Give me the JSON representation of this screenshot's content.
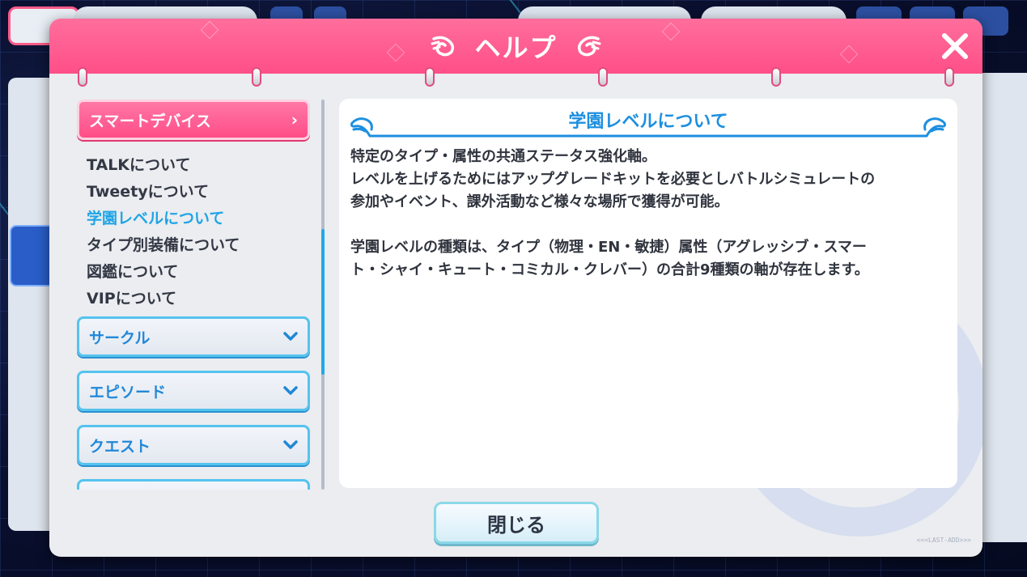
{
  "modal": {
    "title": "ヘルプ",
    "close_icon": "close-icon",
    "bottom_button": "閉じる",
    "watermark": "<<<LAST-ADD>>>"
  },
  "nav": {
    "active_category": "スマートデバイス",
    "sub_items": [
      {
        "label": "TALKについて",
        "active": false
      },
      {
        "label": "Tweetyについて",
        "active": false
      },
      {
        "label": "学園レベルについて",
        "active": true
      },
      {
        "label": "タイプ別装備について",
        "active": false
      },
      {
        "label": "図鑑について",
        "active": false
      },
      {
        "label": "VIPについて",
        "active": false
      }
    ],
    "categories": [
      "サークル",
      "エピソード",
      "クエスト"
    ]
  },
  "content": {
    "title": "学園レベルについて",
    "paragraph1": "特定のタイプ・属性の共通ステータス強化軸。\nレベルを上げるためにはアップグレードキットを必要としバトルシミュレートの\n参加やイベント、課外活動など様々な場所で獲得が可能。",
    "paragraph2": "学園レベルの種類は、タイプ（物理・EN・敏捷）属性（アグレッシブ・スマー\nト・シャイ・キュート・コミカル・クレバー）の合計9種類の軸が存在します。"
  },
  "colors": {
    "header_pink": "#ff5b8f",
    "accent_blue": "#1fa4e6",
    "panel_bg": "#ebedf0"
  }
}
